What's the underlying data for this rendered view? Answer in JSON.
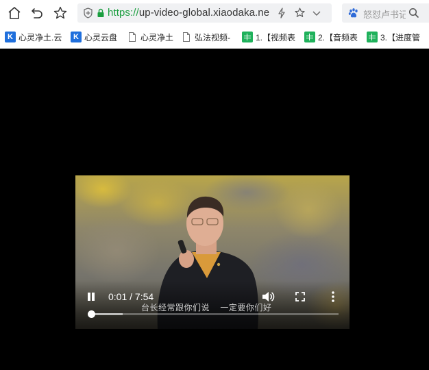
{
  "browser": {
    "url_scheme": "https://",
    "url_rest": "up-video-global.xiaodaka.ne",
    "search_text": "怒怼卢书记"
  },
  "bookmarks": [
    {
      "label": "心灵净土.云",
      "icon": "k-icon"
    },
    {
      "label": "心灵云盘",
      "icon": "k-icon"
    },
    {
      "label": "心灵净土",
      "icon": "doc-icon"
    },
    {
      "label": "弘法视频-",
      "icon": "doc-icon"
    },
    {
      "label": "1.【视频表",
      "icon": "sheet-icon"
    },
    {
      "label": "2.【音频表",
      "icon": "sheet-icon"
    },
    {
      "label": "3.【进度管",
      "icon": "sheet-icon"
    }
  ],
  "video": {
    "time_display": "0:01 / 7:54",
    "subtitle": "台长经常跟你们说    一定要你们好",
    "progress_played": 0.003,
    "progress_buffered": 0.13,
    "state": "playing"
  },
  "colors": {
    "accent_green": "#1a9e3f",
    "kicon_blue": "#1f6fdc",
    "sheet_green": "#1fb15b"
  }
}
